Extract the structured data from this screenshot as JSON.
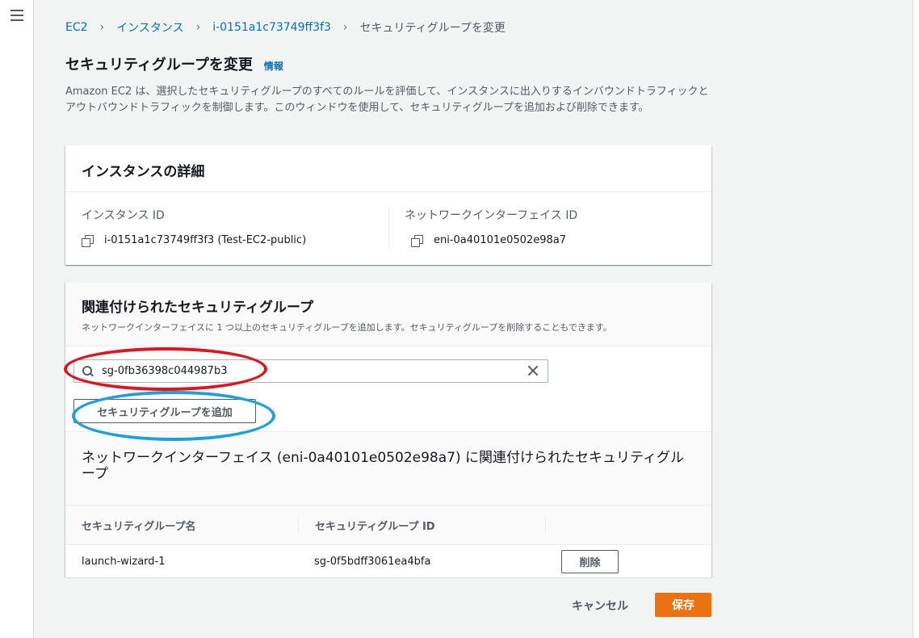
{
  "breadcrumb": {
    "items": [
      "EC2",
      "インスタンス",
      "i-0151a1c73749ff3f3"
    ],
    "current": "セキュリティグループを変更"
  },
  "page": {
    "title": "セキュリティグループを変更",
    "info_link": "情報",
    "description": "Amazon EC2 は、選択したセキュリティグループのすべてのルールを評価して、インスタンスに出入りするインバウンドトラフィックとアウトバウンドトラフィックを制御します。このウィンドウを使用して、セキュリティグループを追加および削除できます。"
  },
  "instance_details": {
    "heading": "インスタンスの詳細",
    "instance_id_label": "インスタンス ID",
    "instance_id_value": "i-0151a1c73749ff3f3 (Test-EC2-public)",
    "eni_label": "ネットワークインターフェイス ID",
    "eni_value": "eni-0a40101e0502e98a7"
  },
  "security_groups": {
    "heading": "関連付けられたセキュリティグループ",
    "subheading": "ネットワークインターフェイスに 1 つ以上のセキュリティグループを追加します。セキュリティグループを削除することもできます。",
    "search_value": "sg-0fb36398c044987b3",
    "add_button": "セキュリティグループを追加",
    "associated_title": "ネットワークインターフェイス (eni-0a40101e0502e98a7) に関連付けられたセキュリティグループ",
    "columns": [
      "セキュリティグループ名",
      "セキュリティグループ ID"
    ],
    "rows": [
      {
        "name": "launch-wizard-1",
        "id": "sg-0f5bdff3061ea4bfa",
        "action": "削除"
      }
    ]
  },
  "footer": {
    "cancel": "キャンセル",
    "save": "保存"
  },
  "colors": {
    "link": "#0073bb",
    "primary_button": "#ec7211",
    "annotation_red": "#e0141e",
    "annotation_blue": "#1ea0dc"
  }
}
